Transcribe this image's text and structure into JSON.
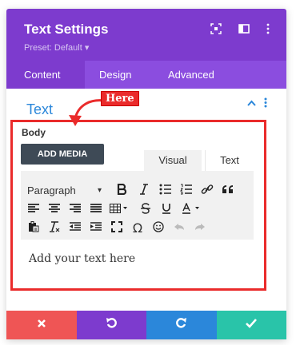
{
  "header": {
    "title": "Text Settings",
    "preset": "Preset: Default ▾",
    "icons": [
      "fullscreen-icon",
      "columns-icon",
      "more-icon"
    ]
  },
  "tabs": [
    {
      "label": "Content"
    },
    {
      "label": "Design"
    },
    {
      "label": "Advanced"
    }
  ],
  "section": {
    "title": "Text",
    "annotation": "Here"
  },
  "body_label": "Body",
  "add_media": "ADD MEDIA",
  "editor_tabs": {
    "visual": "Visual",
    "text": "Text"
  },
  "toolbar": {
    "paragraph": "Paragraph",
    "caret": "▾"
  },
  "editor": {
    "placeholder": "Add your text here"
  },
  "footer": [
    "close-icon",
    "undo-icon",
    "redo-icon",
    "check-icon"
  ],
  "colors": {
    "header": "#7d3bce",
    "tabs": "#8b4ddf",
    "accent_blue": "#2b87da",
    "red": "#ea2b2b",
    "close": "#ef5555",
    "undo": "#7d3bce",
    "redo": "#2b87da",
    "save": "#29c4a9"
  }
}
